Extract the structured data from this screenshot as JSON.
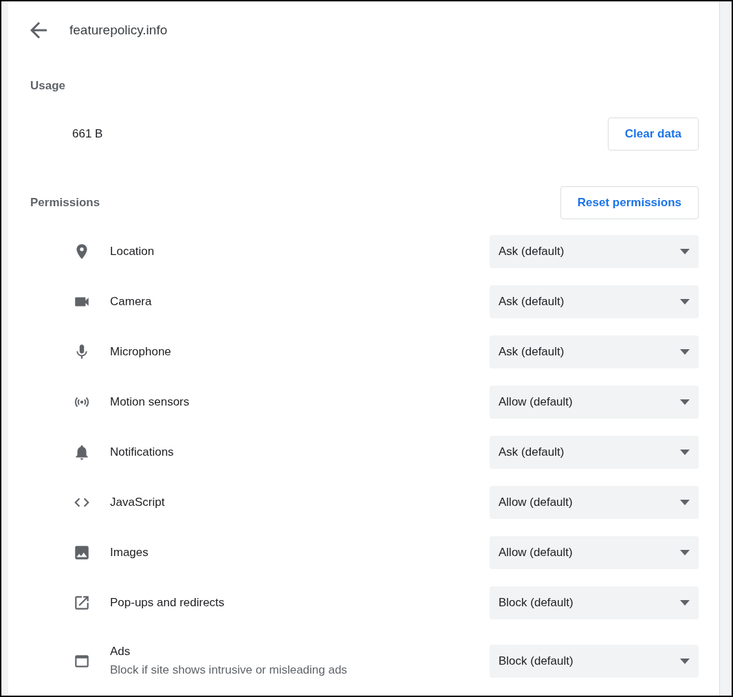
{
  "header": {
    "title": "featurepolicy.info"
  },
  "usage": {
    "heading": "Usage",
    "amount": "661 B",
    "clear_button": "Clear data"
  },
  "permissions": {
    "heading": "Permissions",
    "reset_button": "Reset permissions",
    "items": [
      {
        "label": "Location",
        "value": "Ask (default)"
      },
      {
        "label": "Camera",
        "value": "Ask (default)"
      },
      {
        "label": "Microphone",
        "value": "Ask (default)"
      },
      {
        "label": "Motion sensors",
        "value": "Allow (default)"
      },
      {
        "label": "Notifications",
        "value": "Ask (default)"
      },
      {
        "label": "JavaScript",
        "value": "Allow (default)"
      },
      {
        "label": "Images",
        "value": "Allow (default)"
      },
      {
        "label": "Pop-ups and redirects",
        "value": "Block (default)"
      },
      {
        "label": "Ads",
        "description": "Block if site shows intrusive or misleading ads",
        "value": "Block (default)"
      }
    ]
  }
}
